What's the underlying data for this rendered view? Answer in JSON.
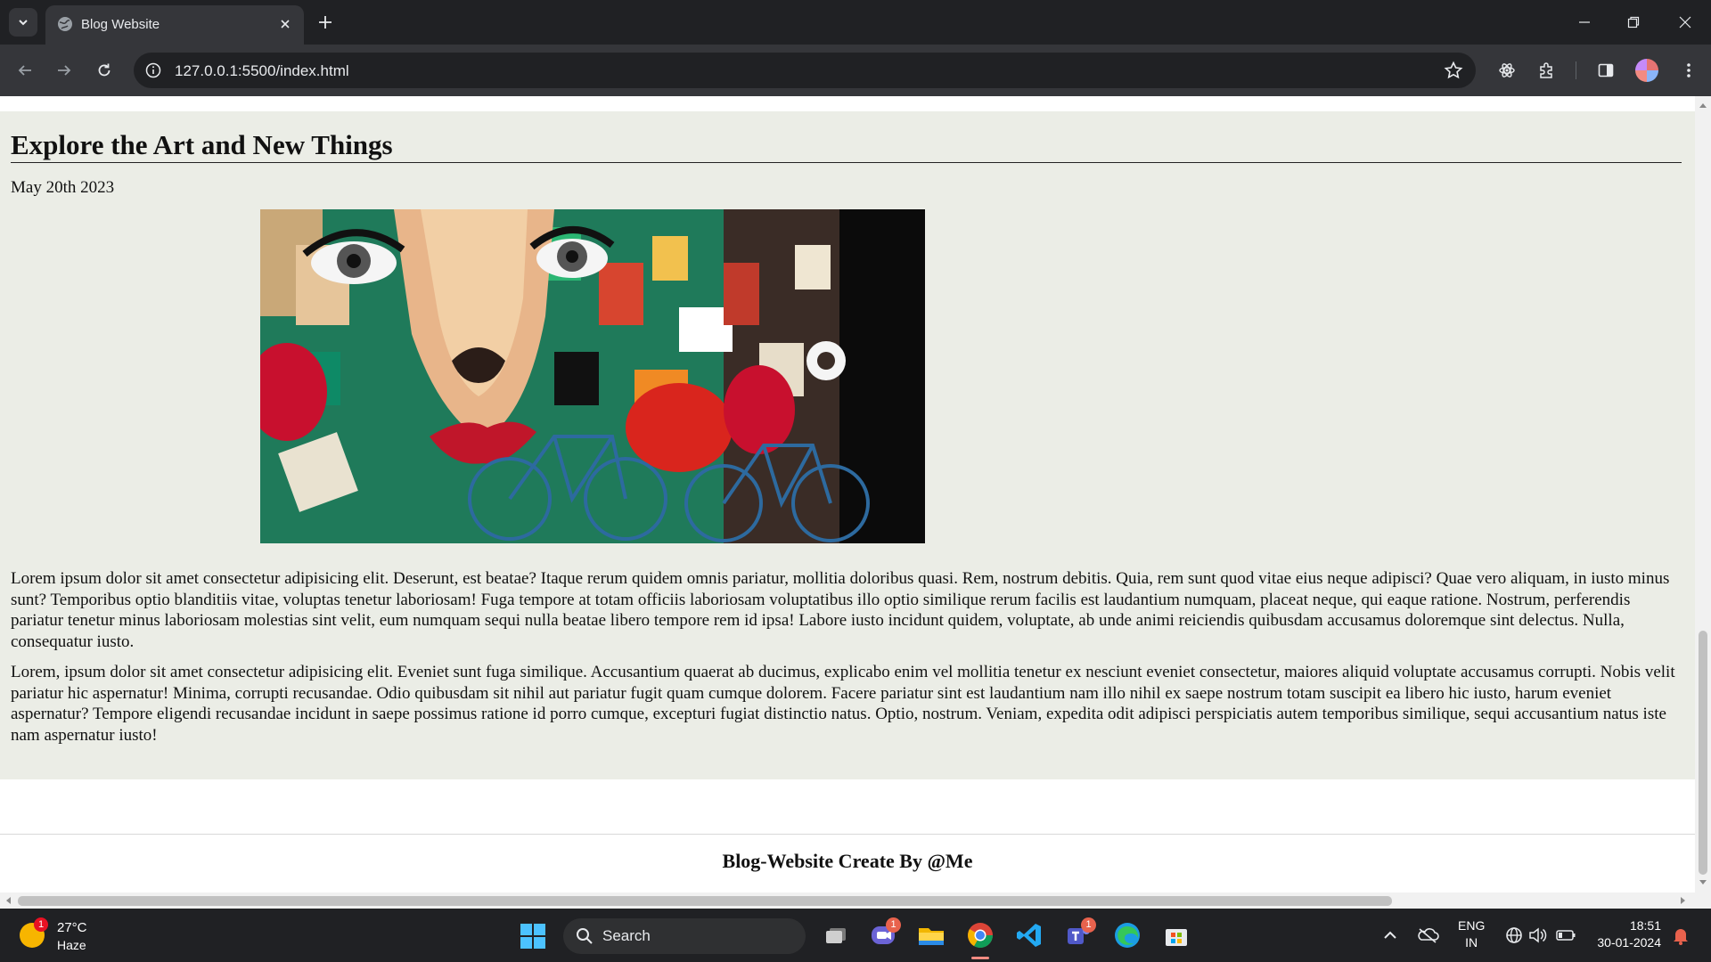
{
  "browser": {
    "tab_title": "Blog Website",
    "url": "127.0.0.1:5500/index.html"
  },
  "article": {
    "title": "Explore the Art and New Things",
    "date": "May 20th 2023",
    "image_icon": "graffiti-mural-image",
    "paragraphs": [
      "Lorem ipsum dolor sit amet consectetur adipisicing elit. Deserunt, est beatae? Itaque rerum quidem omnis pariatur, mollitia doloribus quasi. Rem, nostrum debitis. Quia, rem sunt quod vitae eius neque adipisci? Quae vero aliquam, in iusto minus sunt? Temporibus optio blanditiis vitae, voluptas tenetur laboriosam! Fuga tempore at totam officiis laboriosam voluptatibus illo optio similique rerum facilis est laudantium numquam, placeat neque, qui eaque ratione. Nostrum, perferendis pariatur tenetur minus laboriosam molestias sint velit, eum numquam sequi nulla beatae libero tempore rem id ipsa! Labore iusto incidunt quidem, voluptate, ab unde animi reiciendis quibusdam accusamus doloremque sint delectus. Nulla, consequatur iusto.",
      "Lorem, ipsum dolor sit amet consectetur adipisicing elit. Eveniet sunt fuga similique. Accusantium quaerat ab ducimus, explicabo enim vel mollitia tenetur ex nesciunt eveniet consectetur, maiores aliquid voluptate accusamus corrupti. Nobis velit pariatur hic aspernatur! Minima, corrupti recusandae. Odio quibusdam sit nihil aut pariatur fugit quam cumque dolorem. Facere pariatur sint est laudantium nam illo nihil ex saepe nostrum totam suscipit ea libero hic iusto, harum eveniet aspernatur? Tempore eligendi recusandae incidunt in saepe possimus ratione id porro cumque, excepturi fugiat distinctio natus. Optio, nostrum. Veniam, expedita odit adipisci perspiciatis autem temporibus similique, sequi accusantium natus iste nam aspernatur iusto!"
    ]
  },
  "footer": {
    "text": "Blog-Website Create By @Me"
  },
  "taskbar": {
    "weather_temp": "27°C",
    "weather_cond": "Haze",
    "weather_badge": "1",
    "search_label": "Search",
    "meet_badge": "1",
    "teams_badge": "1",
    "lang_1": "ENG",
    "lang_2": "IN",
    "time": "18:51",
    "date": "30-01-2024"
  },
  "colors": {
    "article_bg": "#ebede6",
    "chrome_bg": "#202124",
    "toolbar_bg": "#35363a",
    "start_accent": "#4cc2ff"
  }
}
